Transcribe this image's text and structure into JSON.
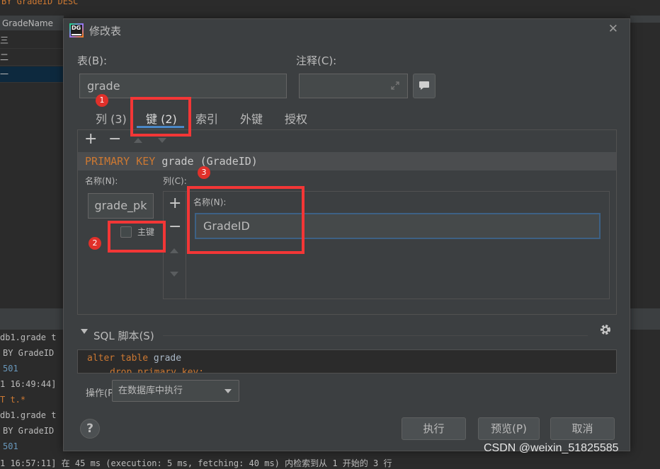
{
  "background": {
    "sql_top": "BY GradeID DESC",
    "grid_header": "GradeName",
    "grid_rows": [
      "三",
      "二",
      "一"
    ],
    "console_lines": [
      "db1.grade t",
      "BY GradeID",
      "501",
      "1 16:49:44]",
      "T t.*",
      "db1.grade t",
      "BY GradeID",
      "501",
      "1 16:57:11] 在 45 ms (execution: 5 ms, fetching: 40 ms) 内检索到从 1 开始的 3 行"
    ]
  },
  "dialog": {
    "logo_text": "DG",
    "title": "修改表",
    "close": "✕",
    "table_label": "表(B):",
    "table_value": "grade",
    "comment_label": "注释(C):",
    "comment_value": "",
    "tabs": [
      "列 (3)",
      "键 (2)",
      "索引",
      "外键",
      "授权"
    ],
    "active_tab": "键 (2)",
    "key_item": {
      "keyword": "PRIMARY KEY",
      "table": "grade",
      "cols": "(GradeID)"
    },
    "name_label": "名称(N):",
    "name_value": "grade_pk",
    "primary_label": "主键",
    "primary_checked": false,
    "columns_label": "列(C):",
    "col_name_label": "名称(N):",
    "col_name_value": "GradeID",
    "sql_section": "SQL 脚本(S)",
    "sql_line1_kw": "alter table",
    "sql_line1_name": "grade",
    "sql_line2": "drop primary key;",
    "op_label": "操作(P):",
    "op_value": "在数据库中执行",
    "help": "?",
    "btn_execute": "执行",
    "btn_preview": "预览(P)",
    "btn_cancel": "取消"
  },
  "annotations": {
    "badge1": "1",
    "badge2": "2",
    "badge3": "3"
  },
  "watermark": "CSDN @weixin_51825585",
  "colors": {
    "accent": "#4a88c7",
    "red_box": "#f33636",
    "keyword": "#cc7832"
  }
}
